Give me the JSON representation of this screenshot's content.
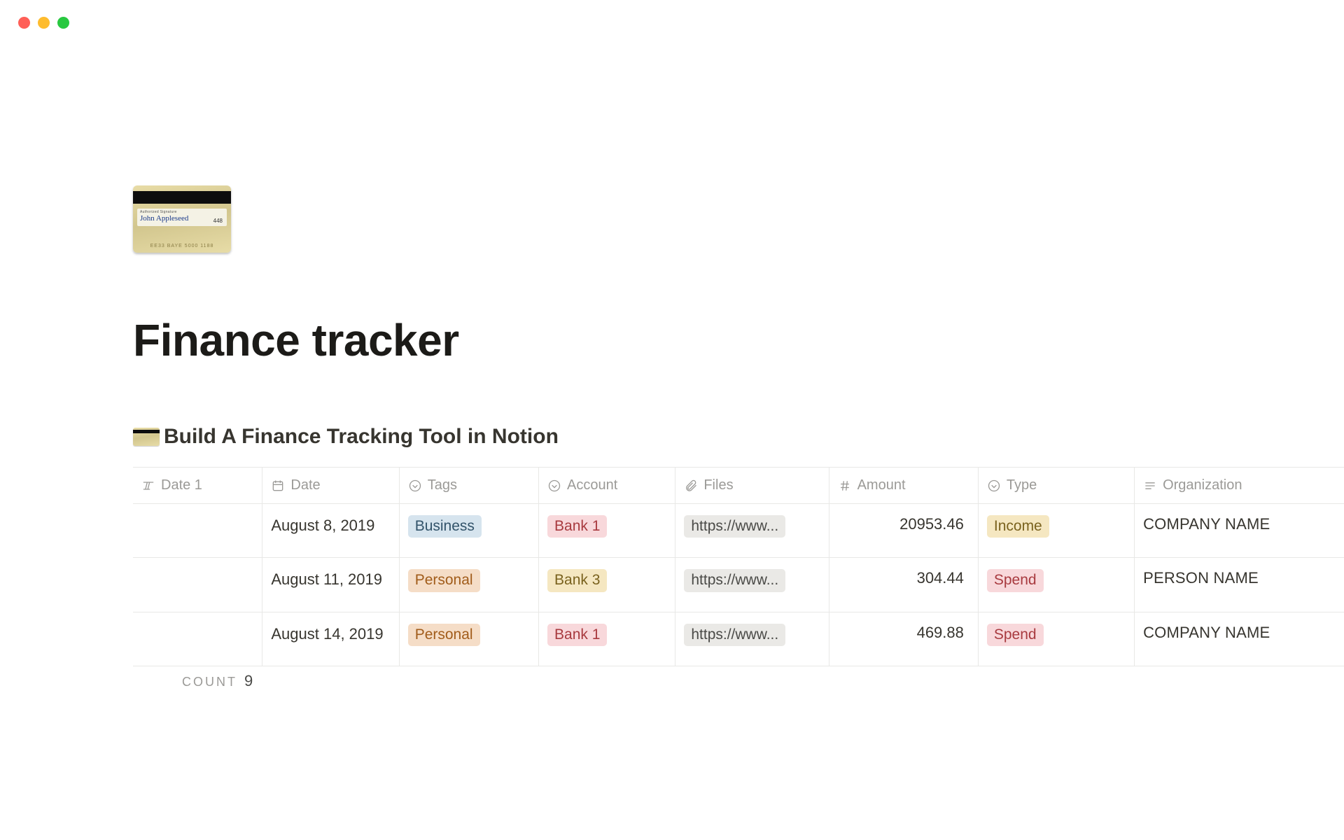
{
  "page": {
    "title": "Finance tracker",
    "subtitle": "Build A Finance Tracking Tool in Notion"
  },
  "icon_card": {
    "auth_label": "Authorized Signature",
    "signature_name": "John Appleseed",
    "cvv": "448",
    "numbers": "EE33 BAYE 5000 1188"
  },
  "columns": {
    "date1": "Date 1",
    "date": "Date",
    "tags": "Tags",
    "account": "Account",
    "files": "Files",
    "amount": "Amount",
    "type": "Type",
    "org": "Organization"
  },
  "rows": [
    {
      "date": "August 8, 2019",
      "tag": {
        "label": "Business",
        "color": "blue"
      },
      "account": {
        "label": "Bank 1",
        "color": "red"
      },
      "file": "https://www...",
      "amount": "20953.46",
      "type": {
        "label": "Income",
        "color": "yellow"
      },
      "org": "COMPANY NAME"
    },
    {
      "date": "August 11, 2019",
      "tag": {
        "label": "Personal",
        "color": "orange"
      },
      "account": {
        "label": "Bank 3",
        "color": "yellow"
      },
      "file": "https://www...",
      "amount": "304.44",
      "type": {
        "label": "Spend",
        "color": "red"
      },
      "org": "PERSON NAME"
    },
    {
      "date": "August 14, 2019",
      "tag": {
        "label": "Personal",
        "color": "orange"
      },
      "account": {
        "label": "Bank 1",
        "color": "red"
      },
      "file": "https://www...",
      "amount": "469.88",
      "type": {
        "label": "Spend",
        "color": "red"
      },
      "org": "COMPANY NAME"
    }
  ],
  "footer": {
    "label": "COUNT",
    "value": "9"
  }
}
